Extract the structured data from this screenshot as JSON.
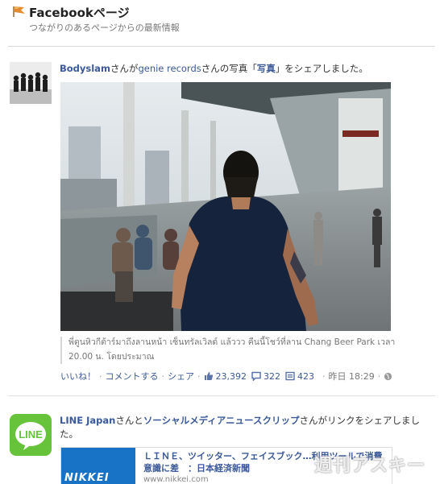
{
  "header": {
    "title": "Facebookページ",
    "subtitle": "つながりのあるページからの最新情報"
  },
  "post1": {
    "actor": "Bodyslam",
    "text_a": "さんが",
    "owner": "genie records",
    "text_b": "さんの写真「",
    "album": "写真",
    "text_c": "」をシェアしました。",
    "caption": "พี่ตูนหิวกีต้าร์มาถึงลานหน้า เซ็นทรัลเวิลด์ แล้ววว คืนนี้โชว์ที่ลาน Chang Beer Park เวลา 20.00 น. โดยประมาณ",
    "actions": {
      "like": "いいね！",
      "comment": "コメントする",
      "share": "シェア"
    },
    "likes": "23,392",
    "comments": "322",
    "shares": "423",
    "time": "昨日 18:29"
  },
  "post2": {
    "actor": "LINE Japan",
    "text_a": "さんと",
    "page": "ソーシャルメディアニュースクリップ",
    "text_b": "さんがリンクをシェアしました。",
    "avatar_label": "LINE",
    "link_thumb_label": "NIKKEI",
    "link_title": "ＬＩＮＥ、ツイッター、フェイスブック…利用ツールで消費意識に差　：日本経済新聞",
    "link_url": "www.nikkei.com"
  },
  "watermark": "週刊アスキー",
  "colors": {
    "link": "#3b5998",
    "line_green": "#67c33a",
    "nikkei_blue": "#1873c7"
  }
}
